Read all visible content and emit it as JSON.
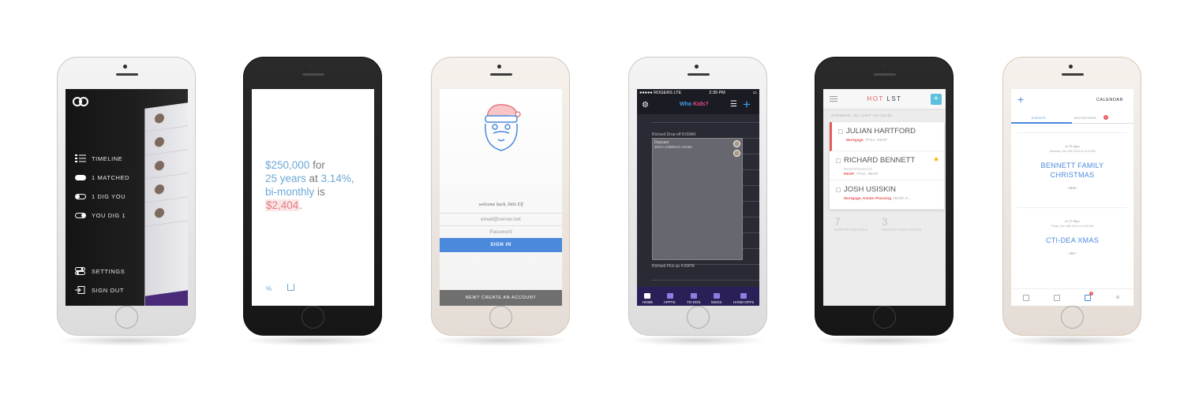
{
  "phone1": {
    "menu": [
      "TIMELINE",
      "1 MATCHED",
      "1 DIG YOU",
      "YOU DIG 1"
    ],
    "bottom_menu": [
      "SETTINGS",
      "SIGN OUT"
    ]
  },
  "phone2": {
    "line1_amount": "$250,000",
    "line1_word": " for",
    "line2_amount": "25 years",
    "line2_word": " at ",
    "line2_rate": "3.14%,",
    "line3_freq": "bi-monthly",
    "line3_word": " is",
    "line4_result": "$2,404",
    "line4_end": ".",
    "footer_percent": "%"
  },
  "phone3": {
    "welcome": "welcome back, little Elf",
    "email_placeholder": "email@server.net",
    "password_placeholder": "Password",
    "signin_label": "SIGN IN",
    "create_label": "NEW? CREATE AN ACCOUNT"
  },
  "phone4": {
    "carrier": "●●●●● ROGERS  LTE",
    "time": "2:39 PM",
    "brand_a": "Who ",
    "brand_b": "Kids?",
    "event1_label": "Richard Drop-off 8:00AM",
    "event_title": "Daycare",
    "event_place": "JNCC Children's Centre",
    "event2_label": "Richard Pick up 4:00PM",
    "tabs": [
      "HOME",
      "APPTS.",
      "TO-DOS",
      "MSGS.",
      "HAND-OFFS"
    ]
  },
  "phone5": {
    "logo_a": "HOT",
    "logo_b": " LST",
    "showing": "SHOWING: ALL  (HOT TO COLD)",
    "contacts": [
      {
        "first": "JULIAN ",
        "last": "HARTFORD",
        "tags": "Mortgage",
        "rest": ", TFSA, RESP"
      },
      {
        "first": "RICHARD ",
        "last": "BENNETT",
        "sub": "NOGOOSIGNCIS",
        "tags": "RESP",
        "rest": ", TFSA, RESP"
      },
      {
        "first": "JOSH ",
        "last": "USISKIN",
        "tags": "Mortgage, Estate Planning",
        "rest": ", RESP, R..."
      }
    ],
    "stats": [
      {
        "n": "7",
        "label": "OPPORTUNITIES"
      },
      {
        "n": "3",
        "label": "PEOPLE HOTLISTED"
      }
    ]
  },
  "phone6": {
    "title": "CALENDAR",
    "tab_events": "EVENTS",
    "tab_invitations": "INVITATIONS",
    "badge": "1",
    "events": [
      {
        "in": "in 15 days",
        "date": "Saturday, Dec 19th 2015 at 10:00 AM",
        "name_a": "BENNETT FAMILY",
        "name_b": "CHRISTMAS",
        "amount": "~ $100 ~"
      },
      {
        "in": "in 17 days",
        "date": "Friday, Dec 18th 2015 at 10:00 AM",
        "name_a": "CTI-DEA XMAS",
        "name_b": "",
        "amount": "~ $25 ~"
      }
    ]
  }
}
